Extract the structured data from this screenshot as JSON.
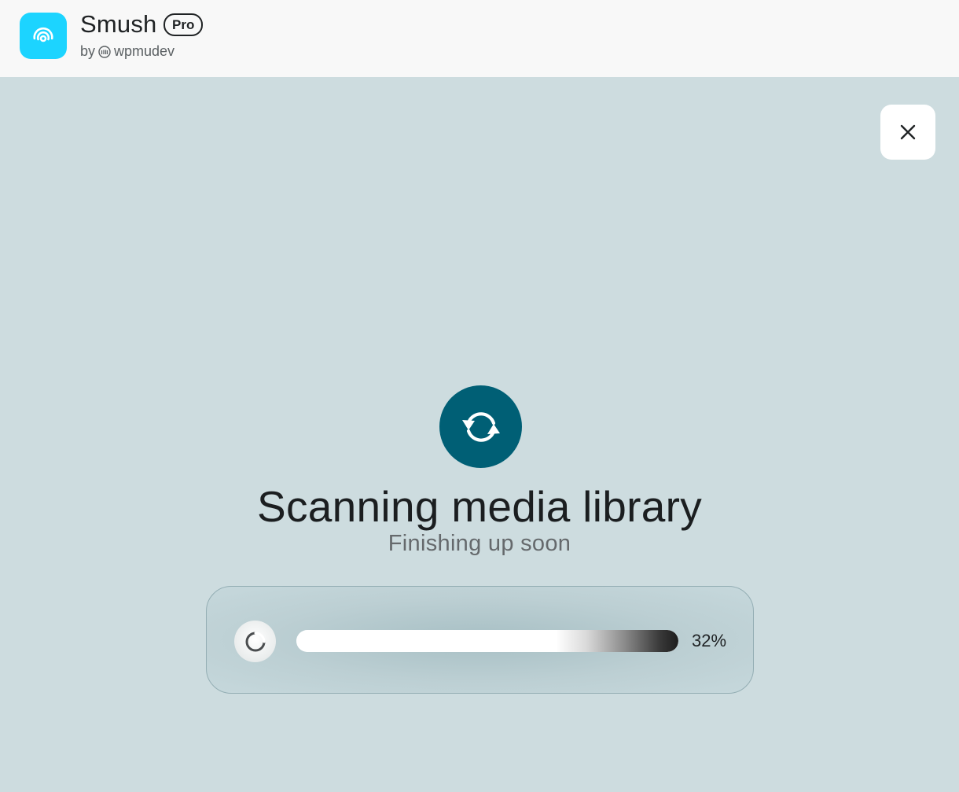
{
  "app": {
    "name": "Smush",
    "badge": "Pro",
    "byline_prefix": "by",
    "developer": "wpmudev",
    "brand_color": "#1cd4ff"
  },
  "dialog": {
    "close_icon": "close-icon",
    "status_icon": "sync-icon",
    "status_icon_color": "#005f75",
    "title": "Scanning media library",
    "subtitle": "Finishing up soon",
    "progress": {
      "percent_label": "32%",
      "value": 0.32
    }
  }
}
